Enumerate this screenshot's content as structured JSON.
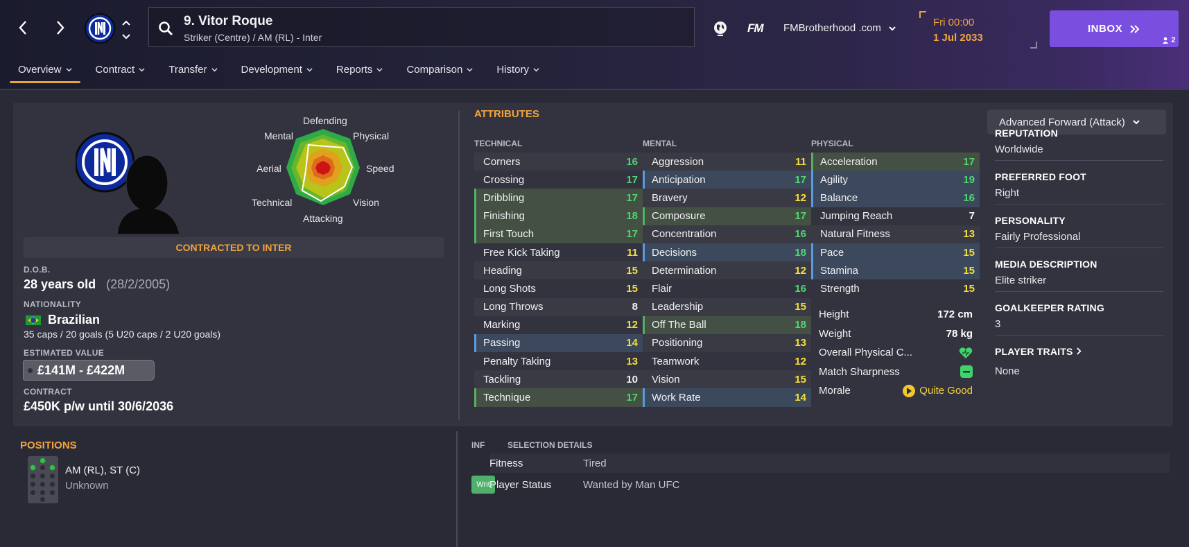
{
  "header": {
    "player_name": "9. Vitor Roque",
    "player_position": "Striker (Centre) / AM (RL) - Inter",
    "brand": "FM",
    "profile_name": "FMBrotherhood .com",
    "date_line1": "Fri 00:00",
    "date_line2": "1 Jul 2033",
    "inbox_label": "INBOX",
    "inbox_count": "2"
  },
  "tabs": [
    "Overview",
    "Contract",
    "Transfer",
    "Development",
    "Reports",
    "Comparison",
    "History"
  ],
  "radar": {
    "labels": {
      "defending": "Defending",
      "physical": "Physical",
      "speed": "Speed",
      "vision": "Vision",
      "attacking": "Attacking",
      "technical": "Technical",
      "aerial": "Aerial",
      "mental": "Mental"
    }
  },
  "profile": {
    "contracted": "CONTRACTED TO INTER",
    "dob_label": "D.O.B.",
    "age": "28 years old",
    "dob": "(28/2/2005)",
    "nationality_label": "NATIONALITY",
    "nationality": "Brazilian",
    "caps": "35 caps / 20 goals (5 U20 caps / 2 U20 goals)",
    "value_label": "ESTIMATED VALUE",
    "value": "£141M - £422M",
    "contract_label": "CONTRACT",
    "contract": "£450K p/w until 30/6/2036"
  },
  "attributes": {
    "title": "ATTRIBUTES",
    "technical_title": "TECHNICAL",
    "mental_title": "MENTAL",
    "physical_title": "PHYSICAL",
    "technical": [
      {
        "name": "Corners",
        "value": "16"
      },
      {
        "name": "Crossing",
        "value": "17"
      },
      {
        "name": "Dribbling",
        "value": "17"
      },
      {
        "name": "Finishing",
        "value": "18"
      },
      {
        "name": "First Touch",
        "value": "17"
      },
      {
        "name": "Free Kick Taking",
        "value": "11"
      },
      {
        "name": "Heading",
        "value": "15"
      },
      {
        "name": "Long Shots",
        "value": "15"
      },
      {
        "name": "Long Throws",
        "value": "8"
      },
      {
        "name": "Marking",
        "value": "12"
      },
      {
        "name": "Passing",
        "value": "14"
      },
      {
        "name": "Penalty Taking",
        "value": "13"
      },
      {
        "name": "Tackling",
        "value": "10"
      },
      {
        "name": "Technique",
        "value": "17"
      }
    ],
    "mental": [
      {
        "name": "Aggression",
        "value": "11"
      },
      {
        "name": "Anticipation",
        "value": "17"
      },
      {
        "name": "Bravery",
        "value": "12"
      },
      {
        "name": "Composure",
        "value": "17"
      },
      {
        "name": "Concentration",
        "value": "16"
      },
      {
        "name": "Decisions",
        "value": "18"
      },
      {
        "name": "Determination",
        "value": "12"
      },
      {
        "name": "Flair",
        "value": "16"
      },
      {
        "name": "Leadership",
        "value": "15"
      },
      {
        "name": "Off The Ball",
        "value": "18"
      },
      {
        "name": "Positioning",
        "value": "13"
      },
      {
        "name": "Teamwork",
        "value": "12"
      },
      {
        "name": "Vision",
        "value": "15"
      },
      {
        "name": "Work Rate",
        "value": "14"
      }
    ],
    "physical": [
      {
        "name": "Acceleration",
        "value": "17"
      },
      {
        "name": "Agility",
        "value": "19"
      },
      {
        "name": "Balance",
        "value": "16"
      },
      {
        "name": "Jumping Reach",
        "value": "7"
      },
      {
        "name": "Natural Fitness",
        "value": "13"
      },
      {
        "name": "Pace",
        "value": "15"
      },
      {
        "name": "Stamina",
        "value": "15"
      },
      {
        "name": "Strength",
        "value": "15"
      }
    ],
    "height_label": "Height",
    "height": "172 cm",
    "weight_label": "Weight",
    "weight": "78 kg",
    "condition_label": "Overall Physical C...",
    "sharpness_label": "Match Sharpness",
    "morale_label": "Morale",
    "morale": "Quite Good"
  },
  "role": {
    "selected": "Advanced Forward (Attack)"
  },
  "details": {
    "reputation_label": "REPUTATION",
    "reputation": "Worldwide",
    "foot_label": "PREFERRED FOOT",
    "foot": "Right",
    "personality_label": "PERSONALITY",
    "personality": "Fairly Professional",
    "media_label": "MEDIA DESCRIPTION",
    "media": "Elite striker",
    "gk_label": "GOALKEEPER RATING",
    "gk": "3",
    "traits_label": "PLAYER TRAITS",
    "traits": "None"
  },
  "positions": {
    "title": "POSITIONS",
    "main": "AM (RL), ST (C)",
    "sub": "Unknown"
  },
  "selection": {
    "inf_label": "INF",
    "title": "SELECTION DETAILS",
    "fitness_label": "Fitness",
    "fitness": "Tired",
    "status_label": "Player Status",
    "status": "Wanted by Man UFC",
    "status_badge": "Wnt"
  },
  "colors": {
    "accent": "#f2a43c",
    "inbox": "#7a4fe0",
    "green_value": "#4fd870",
    "yellow_value": "#f4e03a"
  }
}
